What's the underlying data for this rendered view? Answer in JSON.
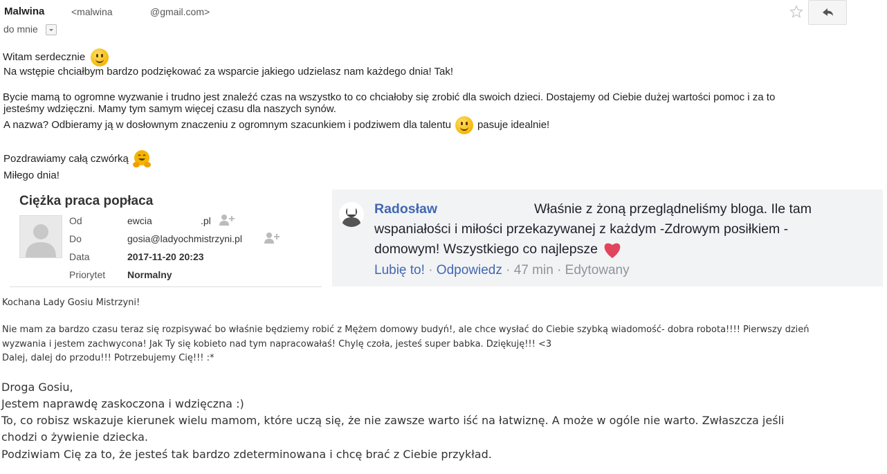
{
  "email1": {
    "sender_name": "Malwina",
    "sender_email_start": "<malwina",
    "sender_email_end": "@gmail.com>",
    "to": "do mnie",
    "greeting": "Witam serdecznie",
    "line1": "Na wstępie chciałbym bardzo podziękować za wsparcie jakiego udzielasz nam każdego dnia! Tak!",
    "line2a": " Bycie mamą to ogromne wyzwanie i trudno jest znaleźć czas na wszystko to co chciałoby się zrobić dla swoich dzieci. Dostajemy od Ciebie dużej wartości pomoc i za to",
    "line2b": "jesteśmy wdzięczni. Mamy tym samym więcej czasu dla naszych synów.",
    "line3a": "A nazwa? Odbieramy ją w dosłownym znaczeniu z ogromnym szacunkiem i podziwem dla talentu",
    "line3b": "pasuje idealnie!",
    "closing1": "Pozdrawiamy całą czwórką",
    "closing2": "Miłego dnia!"
  },
  "email2": {
    "subject": "Ciężka praca popłaca",
    "fields": [
      {
        "label": "Od",
        "value": "ewcia",
        "value2": ".pl"
      },
      {
        "label": "Do",
        "value": "gosia@ladyochmistrzyni.pl"
      },
      {
        "label": "Data",
        "value": "2017-11-20 20:23"
      },
      {
        "label": "Priorytet",
        "value": "Normalny"
      }
    ]
  },
  "fb_comment": {
    "author": "Radosław",
    "text1": "Właśnie z żoną przeglądneliśmy bloga. Ile tam",
    "text2": "wspaniałości i miłości przekazywanej z każdym -Zdrowym posiłkiem -",
    "text3": "domowym! Wszystkiego co najlepsze",
    "like": "Lubię to!",
    "reply": "Odpowiedz",
    "time": "47 min",
    "edited": "Edytowany",
    "sep": "·"
  },
  "message3": {
    "line1": "Kochana Lady Gosiu Mistrzyni!",
    "line2": "Nie mam za bardzo czasu teraz się rozpisywać bo właśnie będziemy robić z Mężem domowy budyń!, ale chce wysłać do Ciebie szybką wiadomość- dobra robota!!!! Pierwszy dzień",
    "line3": "wyzwania i jestem zachwycona! Jak Ty się kobieto nad tym napracowałaś! Chylę czoła, jesteś super babka. Dziękuję!!! <3",
    "line4": "Dalej, dalej do przodu!!! Potrzebujemy Cię!!! :*"
  },
  "message4": {
    "line1": "Droga Gosiu,",
    "line2": "Jestem naprawdę zaskoczona i wdzięczna :)",
    "line3": "To, co robisz wskazuje kierunek wielu mamom, które uczą się, że nie zawsze warto iść na łatwiznę. A może w ogóle nie warto. Zwłaszcza jeśli",
    "line4": "chodzi o żywienie dziecka.",
    "line5": "Podziwiam Cię za to, że jesteś tak bardzo zdeterminowana i chcę brać z Ciebie przykład."
  },
  "colors": {
    "fb_bg": "#f2f3f5",
    "fb_link": "#4267b2",
    "fb_meta": "#90949c"
  },
  "icons": [
    "star-icon",
    "reply-icon",
    "dropdown-icon",
    "smile-emoji",
    "hug-emoji",
    "avatar",
    "add-contact-icon",
    "heart-emoji"
  ]
}
